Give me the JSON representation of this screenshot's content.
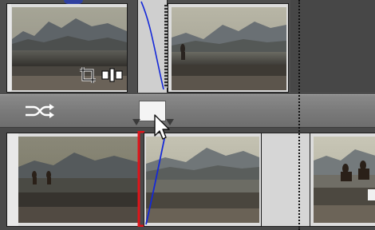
{
  "timeline": {
    "tracks": [
      {
        "name": "upper-video-track",
        "clips": 2
      },
      {
        "name": "lower-video-track",
        "clips": 3
      }
    ],
    "transition_label": "",
    "icons": [
      "crop-icon",
      "trim-icon",
      "shuffle-icon",
      "drag-cursor-icon",
      "transition-marker-icon"
    ]
  },
  "colors": {
    "track_bg": "#4e4e4e",
    "transition_bar": "#7a7a7a",
    "in_point": "#e0141a",
    "curve": "#1428d8",
    "marker_cyan": "#3ed6d6",
    "playhead_dots": "#111111"
  }
}
